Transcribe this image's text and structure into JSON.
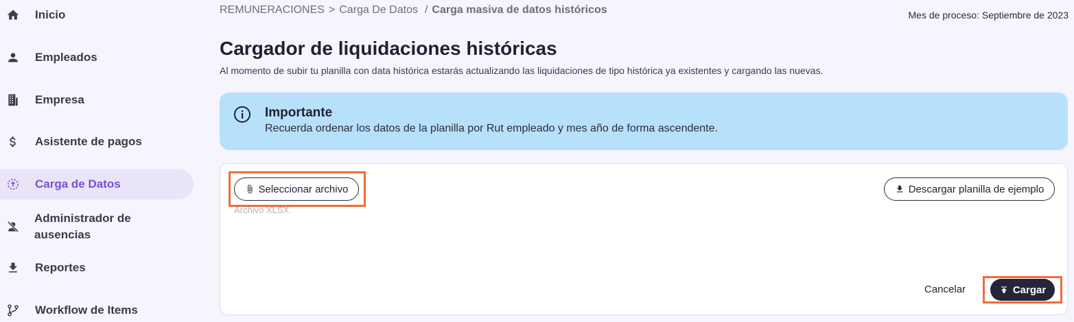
{
  "sidebar": {
    "items": [
      {
        "label": "Inicio",
        "icon": "home-icon"
      },
      {
        "label": "Empleados",
        "icon": "person-icon"
      },
      {
        "label": "Empresa",
        "icon": "building-icon"
      },
      {
        "label": "Asistente de pagos",
        "icon": "dollar-icon"
      },
      {
        "label": "Carga de Datos",
        "icon": "upload-circle-icon",
        "active": true
      },
      {
        "label": "Administrador de ausencias",
        "icon": "person-off-icon"
      },
      {
        "label": "Reportes",
        "icon": "download-icon"
      },
      {
        "label": "Workflow de Items",
        "icon": "branch-icon"
      }
    ]
  },
  "header": {
    "breadcrumb": {
      "root": "REMUNERACIONES",
      "sep1": ">",
      "middle": "Carga De Datos",
      "sep2": "/",
      "current": "Carga masiva de datos históricos"
    },
    "process_month": "Mes de proceso: Septiembre de 2023"
  },
  "main": {
    "title": "Cargador de liquidaciones históricas",
    "subtitle": "Al momento de subir tu planilla con data histórica estarás actualizando las liquidaciones de tipo histórica ya existentes y cargando las nuevas.",
    "alert": {
      "title": "Importante",
      "text": "Recuerda ordenar los datos de la planilla por Rut empleado y mes año de forma ascendente."
    },
    "upload": {
      "select_label": "Seleccionar archivo",
      "file_hint": "Archivo XLSX.",
      "download_label": "Descargar planilla de ejemplo",
      "cancel_label": "Cancelar",
      "submit_label": "Cargar"
    }
  },
  "colors": {
    "accent": "#7a4fd6",
    "alert_bg": "#b7e0fb",
    "highlight": "#f26a3a",
    "primary_button": "#242538"
  }
}
